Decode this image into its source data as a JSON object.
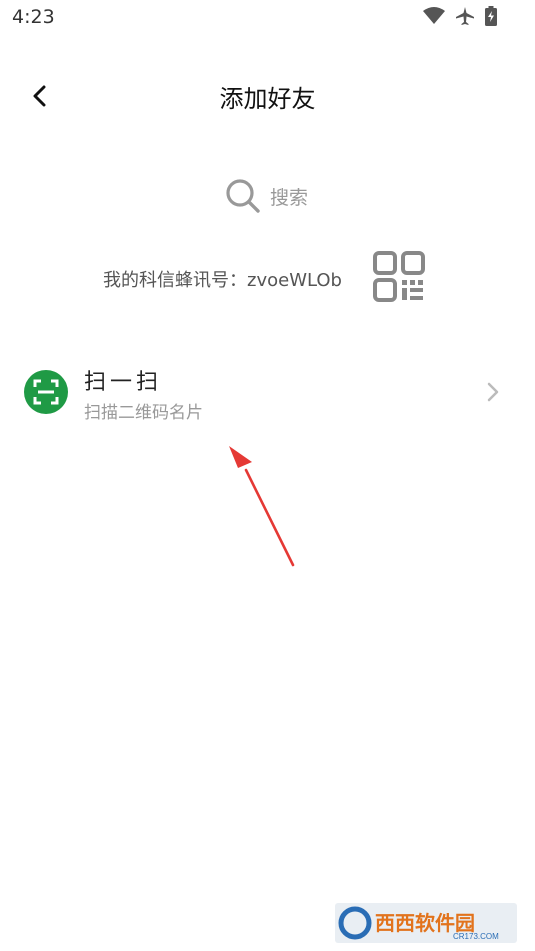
{
  "status_bar": {
    "time": "4:23"
  },
  "header": {
    "title": "添加好友"
  },
  "search": {
    "label": "搜索"
  },
  "account": {
    "prefix": "我的科信蜂讯号：",
    "id": "zvoeWLOb"
  },
  "scan": {
    "title": "扫一扫",
    "subtitle": "扫描二维码名片"
  },
  "watermark": {
    "text": "西西软件园",
    "sub": "CR173.COM"
  },
  "colors": {
    "scan_icon_bg": "#1f9a45",
    "arrow": "#e53935"
  }
}
